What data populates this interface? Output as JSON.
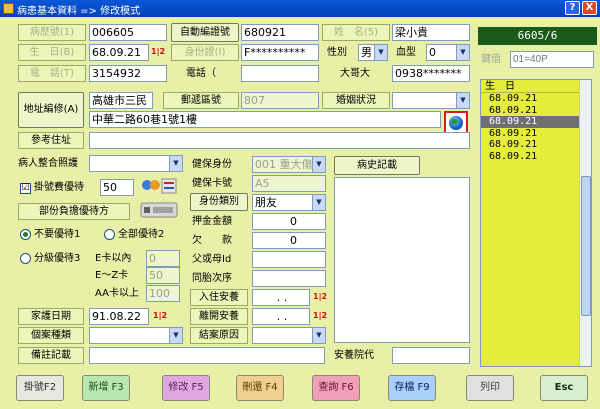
{
  "window": {
    "title": "病患基本資料 => 修改模式",
    "help_label": "?",
    "close_label": "X"
  },
  "form": {
    "medical_record_label": "病歷號(1)",
    "medical_record_value": "006605",
    "auto_number_button": "自動編證號",
    "auto_number_value": "680921",
    "name_label": "姓　名(5)",
    "name_value": "梁小貴",
    "birthday_label": "生　日(B)",
    "birthday_value": "68.09.21",
    "mark12": "1|2",
    "id_label": "身份證(I)",
    "id_value": "F**********",
    "sex_label": "性別",
    "sex_value": "男",
    "blood_label": "血型",
    "blood_value": "0",
    "phone_label": "電　話(T)",
    "phone_value": "3154932",
    "phone2_label": "電話（",
    "phone2_value": "",
    "bigbrother_label": "大哥大",
    "bigbrother_value": "0938*******",
    "address_button": "地址編修(A)",
    "city_value": "高雄市三民",
    "zipcode_label": "郵遞區號",
    "zipcode_value": "807",
    "marriage_label": "婚姻狀況",
    "marriage_value": "",
    "address_value": "中華二路60巷1號1樓",
    "reference_address_label": "參考住址",
    "reference_address_value": ""
  },
  "lower": {
    "care_label": "病人整合照護",
    "care_value": "",
    "registration_fee_label": "掛號費優待",
    "registration_fee_checked": "☑",
    "registration_fee_value": "50",
    "copay_label": "部份負擔優待方",
    "opt_none_label": "不要優待1",
    "opt_all_label": "全部優待2",
    "opt_grade_label": "分級優待3",
    "e_within_label": "E卡以內",
    "e_within_value": "0",
    "ez_label": "E～Z卡",
    "ez_value": "50",
    "aa_label": "AA卡以上",
    "aa_value": "100",
    "health_id_label": "健保身份",
    "health_id_value": "001 重大傷",
    "health_card_label": "健保卡號",
    "health_card_value": "A5",
    "identity_class_label": "身份類別",
    "identity_class_value": "朋友",
    "deposit_label": "押金金額",
    "deposit_value": "0",
    "owed_label": "欠　　款",
    "owed_value": "0",
    "parents_label": "父或母Id",
    "parents_value": "",
    "birth_order_label": "同胎次序",
    "birth_order_value": "",
    "admit_label": "入住安養",
    "admit_value": ".      .",
    "leave_label": "離開安養",
    "leave_value": ".      .",
    "close_reason_label": "結案原因",
    "close_reason_value": "",
    "history_button": "病史記載",
    "family_date_label": "家護日期",
    "family_date_value": "91.08.22",
    "case_type_label": "個案種類",
    "case_type_value": "",
    "note_label": "備註記載",
    "note_value": "",
    "nursing_home_label": "安養院代",
    "nursing_home_value": ""
  },
  "right_pane": {
    "header": "6605/6",
    "search_label": "鍵值",
    "search_placeholder": "01=40P",
    "list_header": "生　日",
    "items": [
      "68.09.21",
      "68.09.21",
      "68.09.21",
      "68.09.21",
      "68.09.21",
      "68.09.21"
    ],
    "selected_index": 2
  },
  "toolbar": {
    "register_label": "掛號F2",
    "add_label": "新增 F3",
    "edit_label": "修改 F5",
    "delete_label": "刪還 F4",
    "query_label": "查詢 F6",
    "save_label": "存檔 F9",
    "print_label": "列印",
    "esc_label": "Esc"
  }
}
